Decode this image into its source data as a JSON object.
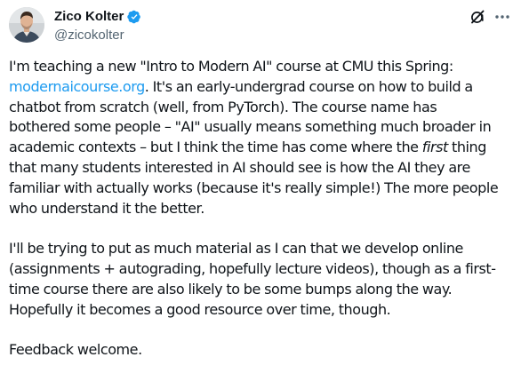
{
  "author": {
    "display_name": "Zico Kolter",
    "handle": "@zicokolter",
    "verified": true,
    "avatar_icon": "profile-photo"
  },
  "header_actions": {
    "grok_icon": "grok-icon",
    "more_icon": "more-options-icon"
  },
  "tweet": {
    "p1": {
      "l1": "I'm teaching a new \"Intro to Modern AI\" course at CMU this Spring:",
      "l2_link": "modernaicourse.org",
      "l2_rest": ". It's an early-undergrad course on how to build a",
      "l3": "chatbot from scratch (well, from PyTorch). The course name has",
      "l4": "bothered some people – \"AI\" usually means something much broader in",
      "l5_a": "academic contexts – but I think the time has come where the ",
      "l5_em": "first",
      "l5_b": " thing",
      "l6": "that many students interested in AI should see is how the AI they are",
      "l7": "familiar with actually works (because it's really simple!) The more people",
      "l8": "who understand it the better."
    },
    "p2": {
      "l1": "I'll be trying to put as much material as I can that we develop online",
      "l2": "(assignments + autograding, hopefully lecture videos), though as a first-",
      "l3": "time course there are also likely to be some bumps along the way.",
      "l4": "Hopefully it becomes a good resource over time, though."
    },
    "p3": {
      "l1": "Feedback welcome."
    }
  },
  "colors": {
    "text": "#0f1419",
    "secondary": "#536471",
    "link": "#1d9bf0",
    "verified": "#1d9bf0"
  }
}
